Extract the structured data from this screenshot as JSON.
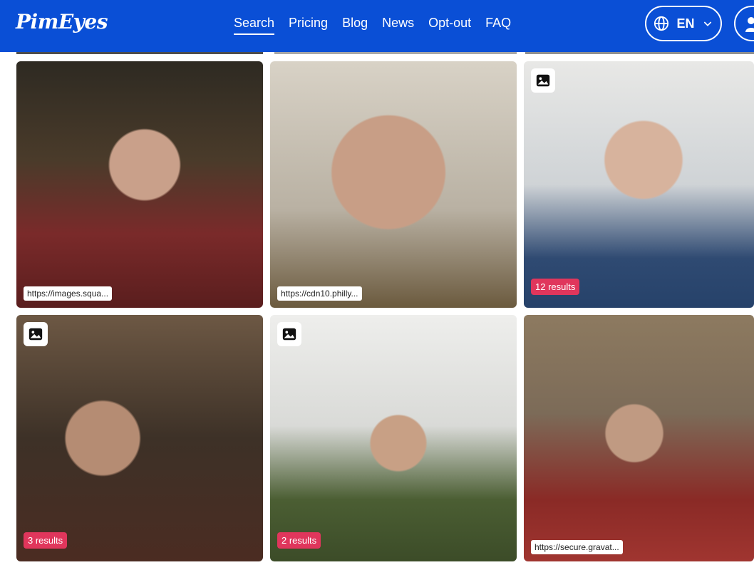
{
  "header": {
    "logo": "PimEyes",
    "nav": [
      "Search",
      "Pricing",
      "Blog",
      "News",
      "Opt-out",
      "FAQ"
    ],
    "active_nav": "Search",
    "language": "EN"
  },
  "cards": [
    {
      "url": "https://images.squa...",
      "results": null,
      "has_photo_icon": false
    },
    {
      "url": "https://cdn10.philly...",
      "results": null,
      "has_photo_icon": false
    },
    {
      "url": null,
      "results": "12 results",
      "has_photo_icon": true
    },
    {
      "url": null,
      "results": "3 results",
      "has_photo_icon": true
    },
    {
      "url": null,
      "results": "2 results",
      "has_photo_icon": true
    },
    {
      "url": "https://secure.gravat...",
      "results": null,
      "has_photo_icon": false
    }
  ],
  "colors": {
    "header_bg": "#0a4fd6",
    "badge": "#e0365c"
  }
}
